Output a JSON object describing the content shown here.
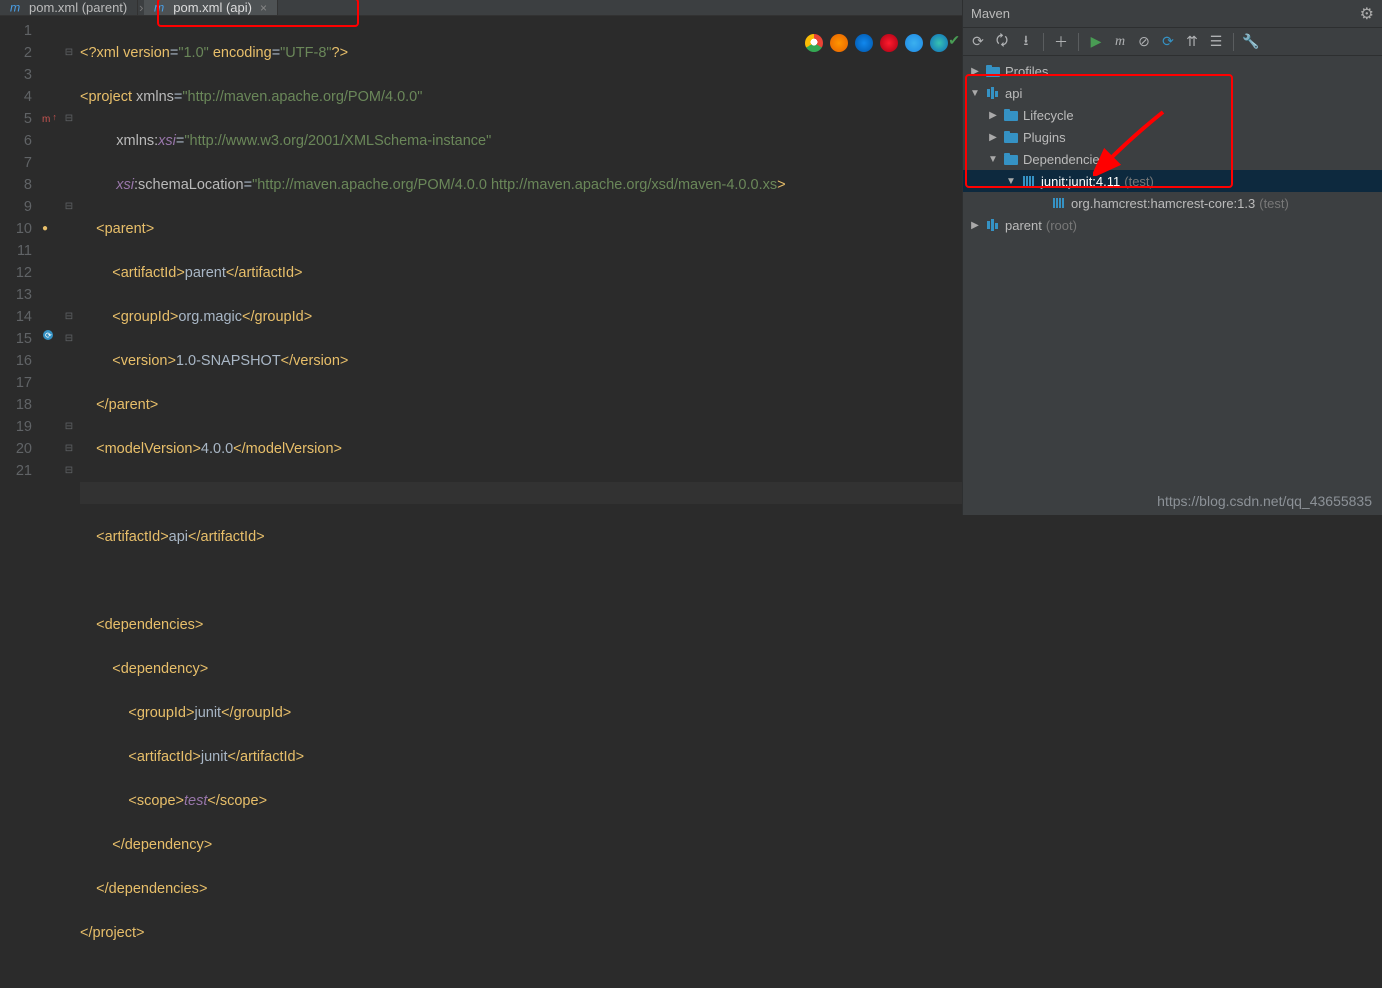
{
  "tabs": [
    {
      "label": "pom.xml (parent)",
      "active": false
    },
    {
      "label": "pom.xml (api)",
      "active": true
    }
  ],
  "gutter_lines": [
    "1",
    "2",
    "3",
    "4",
    "5",
    "6",
    "7",
    "8",
    "9",
    "10",
    "11",
    "12",
    "13",
    "14",
    "15",
    "16",
    "17",
    "18",
    "19",
    "20",
    "21"
  ],
  "code_tokens": {
    "l1": {
      "a": "<?",
      "b": "xml version",
      "c": "=",
      "d": "\"1.0\"",
      "e": " encoding",
      "f": "=",
      "g": "\"UTF-8\"",
      "h": "?>"
    },
    "l2": {
      "a": "<",
      "b": "project ",
      "c": "xmlns",
      "d": "=",
      "e": "\"http://maven.apache.org/POM/4.0.0\""
    },
    "l3": {
      "a": "         ",
      "b": "xmlns:",
      "c": "xsi",
      "d": "=",
      "e": "\"http://www.w3.org/2001/XMLSchema-instance\""
    },
    "l4": {
      "a": "         ",
      "b": "xsi",
      "c": ":schemaLocation",
      "d": "=",
      "e": "\"http://maven.apache.org/POM/4.0.0 http://maven.apache.org/xsd/maven-4.0.0.xs",
      "f": ">"
    },
    "l5": {
      "a": "    <",
      "b": "parent",
      "c": ">"
    },
    "l6": {
      "a": "        <",
      "b": "artifactId",
      "c": ">",
      "d": "parent",
      "e": "</",
      "f": "artifactId",
      "g": ">"
    },
    "l7": {
      "a": "        <",
      "b": "groupId",
      "c": ">",
      "d": "org.magic",
      "e": "</",
      "f": "groupId",
      "g": ">"
    },
    "l8": {
      "a": "        <",
      "b": "version",
      "c": ">",
      "d": "1.0-SNAPSHOT",
      "e": "</",
      "f": "version",
      "g": ">"
    },
    "l9": {
      "a": "    </",
      "b": "parent",
      "c": ">"
    },
    "l10": {
      "a": "    <",
      "b": "modelVersion",
      "c": ">",
      "d": "4.0.0",
      "e": "</",
      "f": "modelVersion",
      "g": ">"
    },
    "l11": {
      "a": ""
    },
    "l12": {
      "a": "    <",
      "b": "artifactId",
      "c": ">",
      "d": "api",
      "e": "</",
      "f": "artifactId",
      "g": ">"
    },
    "l13": {
      "a": ""
    },
    "l14": {
      "a": "    <",
      "b": "dependencies",
      "c": ">"
    },
    "l15": {
      "a": "        <",
      "b": "dependency",
      "c": ">"
    },
    "l16": {
      "a": "            <",
      "b": "groupId",
      "c": ">",
      "d": "junit",
      "e": "</",
      "f": "groupId",
      "g": ">"
    },
    "l17": {
      "a": "            <",
      "b": "artifactId",
      "c": ">",
      "d": "junit",
      "e": "</",
      "f": "artifactId",
      "g": ">"
    },
    "l18": {
      "a": "            <",
      "b": "scope",
      "c": ">",
      "d": "test",
      "e": "</",
      "f": "scope",
      "g": ">"
    },
    "l19": {
      "a": "        </",
      "b": "dependency",
      "c": ">"
    },
    "l20": {
      "a": "    </",
      "b": "dependencies",
      "c": ">"
    },
    "l21": {
      "a": "</",
      "b": "project",
      "c": ">"
    }
  },
  "maven": {
    "title": "Maven",
    "tree": {
      "profiles": "Profiles",
      "api": "api",
      "lifecycle": "Lifecycle",
      "plugins": "Plugins",
      "dependencies": "Dependencies",
      "junit": "junit:junit:4.11",
      "junit_scope": "(test)",
      "hamcrest": "org.hamcrest:hamcrest-core:1.3",
      "hamcrest_scope": "(test)",
      "parent": "parent",
      "parent_scope": "(root)"
    }
  },
  "watermark": "https://blog.csdn.net/qq_43655835",
  "colors": {
    "bg": "#2b2b2b",
    "panel": "#3c3f41",
    "accent": "#0d293e",
    "tag": "#e8bf6a",
    "str": "#6a8759",
    "red": "#ff0000"
  }
}
